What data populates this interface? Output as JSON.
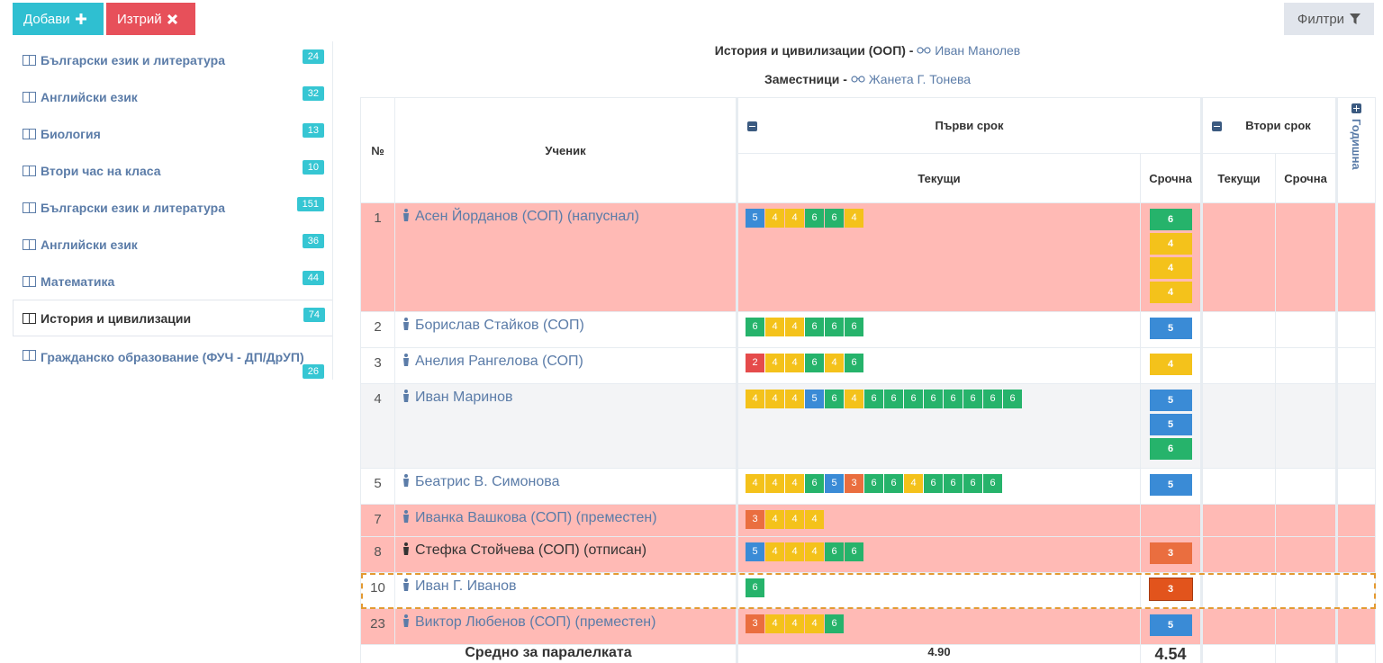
{
  "toolbar": {
    "add_label": "Добави",
    "delete_label": "Изтрий",
    "filter_label": "Филтри"
  },
  "sidebar": {
    "items": [
      {
        "label": "Български език и литература",
        "count": "24"
      },
      {
        "label": "Английски език",
        "count": "32"
      },
      {
        "label": "Биология",
        "count": "13"
      },
      {
        "label": "Втори час на класа",
        "count": "10"
      },
      {
        "label": "Български език и литература",
        "count": "151"
      },
      {
        "label": "Английски език",
        "count": "36"
      },
      {
        "label": "Математика",
        "count": "44"
      },
      {
        "label": "История и цивилизации",
        "count": "74",
        "active": true
      },
      {
        "label": "Гражданско образование (ФУЧ - ДП/ДрУП)",
        "count": "26"
      }
    ]
  },
  "header": {
    "subject": "История и цивилизации (ООП)",
    "dash": " - ",
    "teacher": "Иван Манолев",
    "deputies_label": "Заместници",
    "deputy": "Жанета Г. Тонева"
  },
  "table": {
    "col_no": "№",
    "col_student": "Ученик",
    "term1": "Първи срок",
    "term2": "Втори срок",
    "year": "Годишна",
    "current": "Текущи",
    "exam": "Срочна",
    "rows": [
      {
        "no": "1",
        "name": "Асен Йорданов (СОП) (напуснал)",
        "grades": [
          "5",
          "4",
          "4",
          "6",
          "6",
          "4"
        ],
        "exam": [
          "6",
          "4",
          "4",
          "4"
        ],
        "style": "pink"
      },
      {
        "no": "2",
        "name": "Борислав Стайков (СОП)",
        "grades": [
          "6",
          "4",
          "4",
          "6",
          "6",
          "6"
        ],
        "exam": [
          "5"
        ],
        "style": ""
      },
      {
        "no": "3",
        "name": "Анелия Рангелова (СОП)",
        "grades": [
          "2",
          "4",
          "4",
          "6",
          "4",
          "6"
        ],
        "exam": [
          "4"
        ],
        "style": ""
      },
      {
        "no": "4",
        "name": "Иван Маринов",
        "grades": [
          "4",
          "4",
          "4",
          "5",
          "6",
          "4",
          "6",
          "6",
          "6",
          "6",
          "6",
          "6",
          "6",
          "6"
        ],
        "exam": [
          "5",
          "5",
          "6"
        ],
        "style": "gray"
      },
      {
        "no": "5",
        "name": "Беатрис В. Симонова",
        "grades": [
          "4",
          "4",
          "4",
          "6",
          "5",
          "3",
          "6",
          "6",
          "4",
          "6",
          "6",
          "6",
          "6"
        ],
        "exam": [
          "5"
        ],
        "style": ""
      },
      {
        "no": "7",
        "name": "Иванка Вашкова (СОП) (преместен)",
        "grades": [
          "3",
          "4",
          "4",
          "4"
        ],
        "exam": [],
        "style": "pink"
      },
      {
        "no": "8",
        "name": "Стефка Стойчева (СОП) (отписан)",
        "grades": [
          "5",
          "4",
          "4",
          "4",
          "6",
          "6"
        ],
        "exam": [
          "3"
        ],
        "style": "pink",
        "dark": true
      },
      {
        "no": "10",
        "name": "Иван Г. Иванов",
        "grades": [
          "6"
        ],
        "exam": [
          "3"
        ],
        "style": "highlight"
      },
      {
        "no": "23",
        "name": "Виктор Любенов (СОП) (преместен)",
        "grades": [
          "3",
          "4",
          "4",
          "4",
          "6"
        ],
        "exam": [
          "5"
        ],
        "style": "pink"
      }
    ],
    "avg_label": "Средно за паралелката",
    "avg_current": "4.90",
    "avg_exam": "4.54"
  },
  "colors": {
    "grade_6": "#26b36b",
    "grade_5": "#3a8bd6",
    "grade_4": "#f4c21b",
    "grade_3": "#ea6e3f",
    "grade_2": "#e54b4b",
    "add_button": "#2fbfd1",
    "delete_button": "#e7505a",
    "withdrawn_row": "#ffbab5"
  },
  "icons": {
    "add": "plus-icon",
    "delete": "times-icon",
    "filter": "filter-icon",
    "subject": "book-icon",
    "student": "person-icon",
    "teacher": "glasses-icon"
  }
}
